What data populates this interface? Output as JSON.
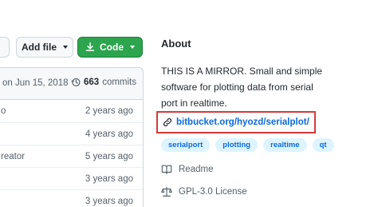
{
  "toolbar": {
    "add_file_label": "Add file",
    "code_label": "Code",
    "code_color": "#2da44e"
  },
  "commit_bar": {
    "date_text": "on Jun 15, 2018",
    "commit_count": "663",
    "commits_label": "commits"
  },
  "files": [
    {
      "message": "o",
      "age": "2 years ago"
    },
    {
      "message": "",
      "age": "4 years ago"
    },
    {
      "message": "reator",
      "age": "5 years ago"
    },
    {
      "message": "",
      "age": "3 years ago"
    },
    {
      "message": "",
      "age": "3 years ago"
    }
  ],
  "about": {
    "title": "About",
    "description": "THIS IS A MIRROR. Small and simple software for plotting data from serial port in realtime.",
    "website": "bitbucket.org/hyozd/serialplot/",
    "topics": [
      "serialport",
      "plotting",
      "realtime",
      "qt"
    ],
    "readme_label": "Readme",
    "license_label": "GPL-3.0 License"
  },
  "icons": {
    "download": "download-icon",
    "history": "history-icon",
    "link": "link-icon",
    "readme": "book-icon",
    "license": "law-icon"
  },
  "colors": {
    "link": "#0969da",
    "topic_bg": "#ddf4ff",
    "highlight_border": "#d73a3a"
  }
}
